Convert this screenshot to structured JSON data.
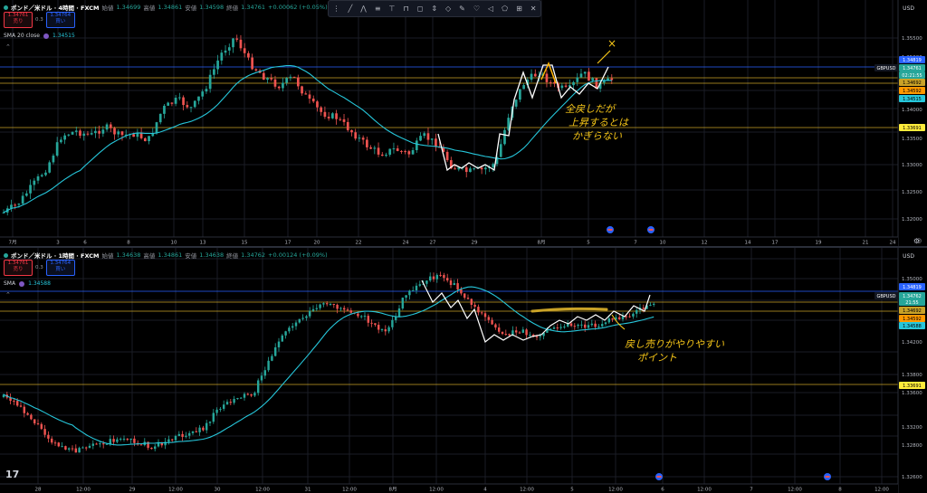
{
  "pane1": {
    "symbol": "ポンド／米ドル · 4時間 · FXCM",
    "open_label": "始値",
    "open": "1.34699",
    "high_label": "高値",
    "high": "1.34861",
    "low_label": "安値",
    "low": "1.34598",
    "close_label": "終値",
    "close": "1.34761",
    "change": "+0.00062 (+0.05%)",
    "sell_price": "1.34761",
    "sell_label": "売り",
    "spread": "0.3",
    "buy_price": "1.34764",
    "buy_label": "買い",
    "sma_label": "SMA 20 close",
    "sma_value": "1.34515",
    "currency": "USD",
    "price_labels": [
      "1.35500",
      "1.35000",
      "1.34000",
      "1.33500",
      "1.33000",
      "1.32500",
      "1.32000"
    ],
    "tags": {
      "p1": "1.34819",
      "sym": "GBPUSD",
      "price": "1.34761",
      "time": "02:21:55",
      "p2": "1.34692",
      "p3": "1.34592",
      "sma": "1.34515",
      "p4": "1.33691"
    },
    "time_labels": [
      "7月",
      "3",
      "6",
      "8",
      "10",
      "13",
      "15",
      "17",
      "20",
      "22",
      "24",
      "27",
      "29",
      "8月",
      "5",
      "7",
      "10",
      "12",
      "14",
      "17",
      "19",
      "21",
      "24"
    ],
    "annotation": "全戻しだが\n上昇するとは\nかぎらない"
  },
  "pane2": {
    "symbol": "ポンド／米ドル · 1時間 · FXCM",
    "open_label": "始値",
    "open": "1.34638",
    "high_label": "高値",
    "high": "1.34861",
    "low_label": "安値",
    "low": "1.34638",
    "close_label": "終値",
    "close": "1.34762",
    "change": "+0.00124 (+0.09%)",
    "sell_price": "1.34761",
    "sell_label": "売り",
    "spread": "0.3",
    "buy_price": "1.34764",
    "buy_label": "買い",
    "sma_label": "SMA",
    "sma_value": "1.34588",
    "currency": "USD",
    "price_labels": [
      "1.35000",
      "1.34600",
      "1.34200",
      "1.33800",
      "1.33600",
      "1.33200",
      "1.32800",
      "1.32600"
    ],
    "tags": {
      "p1": "1.34819",
      "sym": "GBPUSD",
      "price": "1.34762",
      "time": "21:55",
      "p2": "1.34692",
      "p3": "1.34592",
      "sma": "1.34588",
      "p4": "1.33691"
    },
    "time_labels": [
      "28",
      "12:00",
      "29",
      "12:00",
      "30",
      "12:00",
      "31",
      "12:00",
      "8月",
      "12:00",
      "4",
      "12:00",
      "5",
      "12:00",
      "6",
      "12:00",
      "7",
      "12:00",
      "8",
      "12:00"
    ],
    "annotation": "戻し売りがやりやすい\nポイント"
  },
  "colors": {
    "up": "#26a69a",
    "down": "#ef5350",
    "sma": "#26c6da",
    "level": "#c9a227",
    "blue": "#2962ff",
    "annot": "#f5c518"
  },
  "toolbar_icons": [
    "cursor-icon",
    "trend-line-icon",
    "fib-icon",
    "brush-icon",
    "text-icon",
    "ruler-icon",
    "zoom-icon",
    "magnet-icon",
    "lock-icon",
    "eye-icon",
    "trash-icon",
    "layers-icon"
  ]
}
